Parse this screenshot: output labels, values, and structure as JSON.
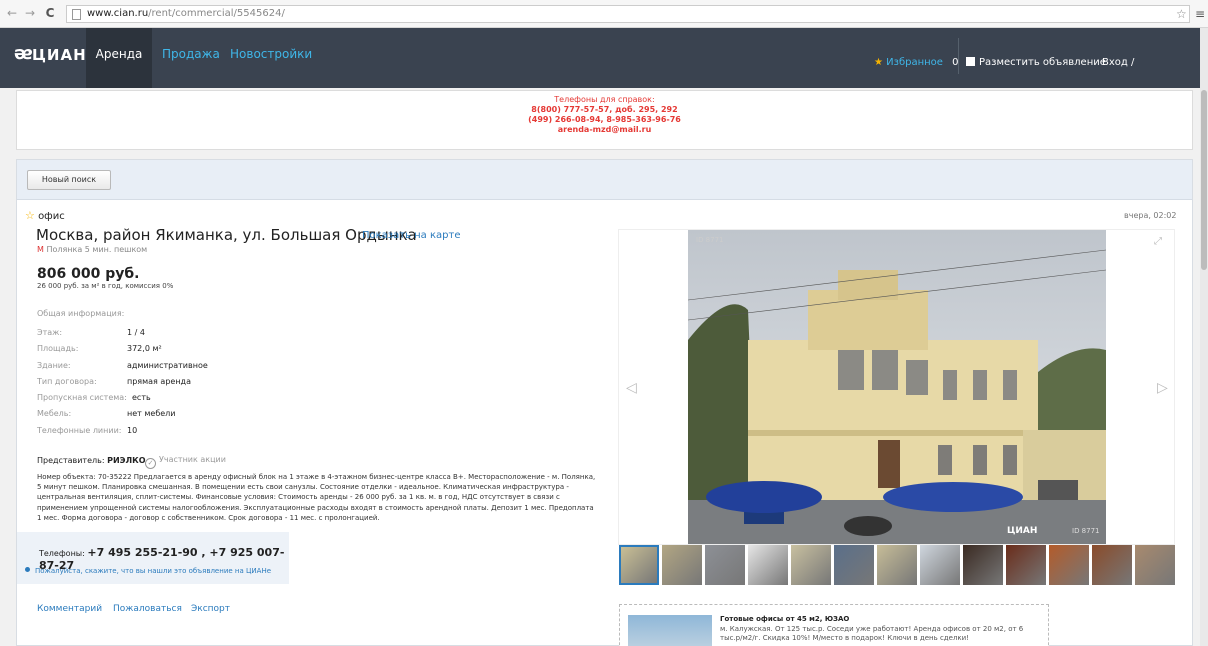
{
  "browser": {
    "url_domain": "www.cian.ru",
    "url_path": "/rent/commercial/5545624/"
  },
  "header": {
    "logo": "ЦИАН",
    "tabs": [
      "Аренда",
      "Продажа",
      "Новостройки"
    ],
    "favorites_label": "Избранное",
    "favorites_count": "0",
    "post_ad": "Разместить объявление",
    "login": "Вход / Регистрация"
  },
  "banner": {
    "line1": "Телефоны для справок:",
    "line2": "8(800) 777-57-57, доб. 295, 292",
    "line3": "(499) 266-08-94, 8-985-363-96-76",
    "line4": "arenda-mzd@mail.ru"
  },
  "search": {
    "new_search": "Новый поиск"
  },
  "offer": {
    "type": "офис",
    "date": "вчера, 02:02",
    "address": "Москва, район Якиманка, ул. Большая Ордынка",
    "map_link": "Показать на карте",
    "metro_icon": "М",
    "metro": "Полянка 5 мин. пешком",
    "price": "806 000 руб.",
    "price_note": "26 000 руб. за м² в год, комиссия 0%",
    "info_header": "Общая информация:",
    "info": [
      {
        "k": "Этаж:",
        "v": "1 / 4"
      },
      {
        "k": "Площадь:",
        "v": "372,0 м²"
      },
      {
        "k": "Здание:",
        "v": "административное"
      },
      {
        "k": "Тип договора:",
        "v": "прямая аренда"
      },
      {
        "k": "Пропускная система:",
        "v": "есть"
      },
      {
        "k": "Мебель:",
        "v": "нет мебели"
      },
      {
        "k": "Телефонные линии:",
        "v": "10"
      }
    ],
    "rep_label": "Представитель:",
    "rep_name": "РИЭЛКО",
    "partner": "Участник акции",
    "description": "Номер объекта: 70-35222 Предлагается в аренду офисный блок на 1 этаже в 4-этажном бизнес-центре класса В+. Месторасположение - м. Полянка, 5 минут пешком. Планировка смешанная. В помещении есть свои санузлы. Состояние отделки - идеальное. Климатическая инфраструктура - центральная вентиляция, сплит-системы. Финансовые условия: Стоимость аренды - 26 000 руб. за 1 кв. м. в год, НДС отсутствует в связи с применением упрощенной системы налогообложения. Эксплуатационные расходы входят в стоимость арендной платы. Депозит 1 мес. Предоплата 1 мес. Форма договора - договор с собственником. Срок договора - 11 мес. с пролонгацией.",
    "phones_label": "Телефоны:",
    "phones": "+7 495 255-21-90 , +7 925 007-87-27",
    "thanks": "Пожалуйста, скажите, что вы нашли это объявление на ЦИАНе",
    "links": [
      "Комментарий",
      "Пожаловаться",
      "Экспорт"
    ]
  },
  "gallery": {
    "watermark_logo": "ЦИАН",
    "watermark_id": "ID 8771",
    "thumb_count": 13
  },
  "ad": {
    "title": "Готовые офисы от 45 м2, ЮЗАО",
    "text": "м. Калужская. От 125 тыс.р. Соседи уже работают! Аренда офисов от 20 м2, от 6 тыс.р/м2/г. Скидка 10%! М/место в подарок! Ключи в день сделки!"
  },
  "colors": {
    "header_bg": "#3a4350",
    "link": "#2b7bbd",
    "accent_blue": "#3fb6e8",
    "banner_red": "#e53935",
    "star": "#f5b301"
  }
}
